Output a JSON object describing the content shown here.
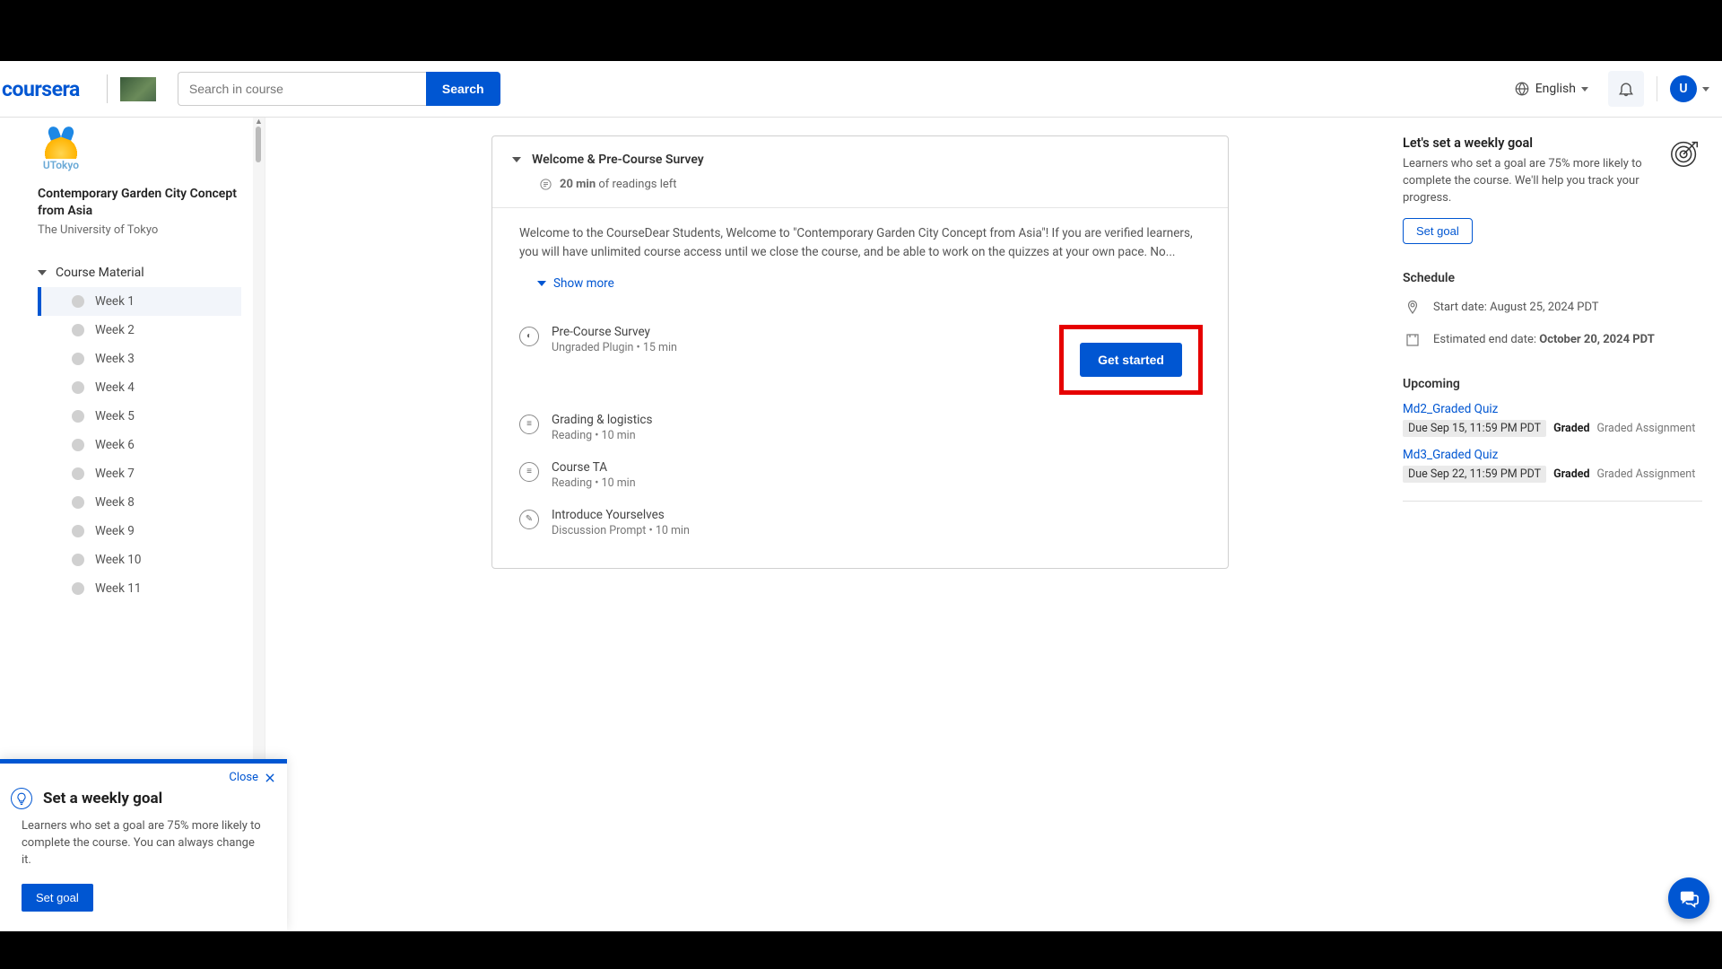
{
  "header": {
    "logo": "coursera",
    "search_placeholder": "Search in course",
    "search_button": "Search",
    "language": "English",
    "avatar_letter": "U"
  },
  "sidebar": {
    "uni_short": "UTokyo",
    "course_title": "Contemporary Garden City Concept from Asia",
    "university": "The University of Tokyo",
    "course_material": "Course Material",
    "weeks": [
      {
        "label": "Week 1",
        "active": true
      },
      {
        "label": "Week 2",
        "active": false
      },
      {
        "label": "Week 3",
        "active": false
      },
      {
        "label": "Week 4",
        "active": false
      },
      {
        "label": "Week 5",
        "active": false
      },
      {
        "label": "Week 6",
        "active": false
      },
      {
        "label": "Week 7",
        "active": false
      },
      {
        "label": "Week 8",
        "active": false
      },
      {
        "label": "Week 9",
        "active": false
      },
      {
        "label": "Week 10",
        "active": false
      },
      {
        "label": "Week 11",
        "active": false
      }
    ]
  },
  "lesson": {
    "title": "Welcome & Pre-Course Survey",
    "time_bold": "20 min",
    "time_rest": "of readings left",
    "description": "Welcome to the CourseDear Students, Welcome to \"Contemporary Garden City Concept from Asia\"! If you are verified learners, you will have unlimited course access until we close the course, and be able to work on the quizzes at your own pace. No...",
    "show_more": "Show more",
    "get_started": "Get started",
    "items": [
      {
        "title": "Pre-Course Survey",
        "meta": "Ungraded Plugin • 15 min",
        "icon": "plugin"
      },
      {
        "title": "Grading & logistics",
        "meta": "Reading • 10 min",
        "icon": "reading"
      },
      {
        "title": "Course TA",
        "meta": "Reading • 10 min",
        "icon": "reading"
      },
      {
        "title": "Introduce Yourselves",
        "meta": "Discussion Prompt • 10 min",
        "icon": "discussion"
      }
    ]
  },
  "rightcol": {
    "goal_title": "Let's set a weekly goal",
    "goal_desc": "Learners who set a goal are 75% more likely to complete the course. We'll help you track your progress.",
    "set_goal": "Set goal",
    "schedule_title": "Schedule",
    "start_label": "Start date: ",
    "start_value": "August 25, 2024 PDT",
    "end_label": "Estimated end date: ",
    "end_value": "October 20, 2024 PDT",
    "upcoming_title": "Upcoming",
    "upcoming": [
      {
        "name": "Md2_Graded Quiz",
        "due": "Due Sep 15, 11:59 PM PDT",
        "graded": "Graded",
        "type": "Graded Assignment"
      },
      {
        "name": "Md3_Graded Quiz",
        "due": "Due Sep 22, 11:59 PM PDT",
        "graded": "Graded",
        "type": "Graded Assignment"
      }
    ]
  },
  "popup": {
    "close": "Close",
    "title": "Set a weekly goal",
    "desc": "Learners who set a goal are 75% more likely to complete the course. You can always change it.",
    "button": "Set goal"
  }
}
